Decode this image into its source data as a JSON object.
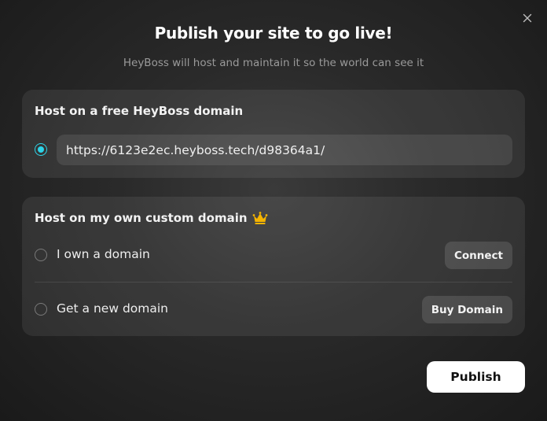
{
  "dialog": {
    "title": "Publish your site to go live!",
    "subtitle": "HeyBoss will host and maintain it so the world can see it",
    "close_icon": "close-icon"
  },
  "free_domain": {
    "heading": "Host on a free HeyBoss domain",
    "selected": true,
    "url": "https://6123e2ec.heyboss.tech/d98364a1/"
  },
  "custom_domain": {
    "heading": "Host on my own custom domain",
    "badge_icon": "crown-icon",
    "options": [
      {
        "label": "I own a domain",
        "button_label": "Connect",
        "selected": false
      },
      {
        "label": "Get a new domain",
        "button_label": "Buy Domain",
        "selected": false
      }
    ]
  },
  "actions": {
    "publish_label": "Publish"
  },
  "colors": {
    "accent": "#2dd4e8",
    "crown": "#f5b400",
    "publish_bg": "#ffffff"
  }
}
